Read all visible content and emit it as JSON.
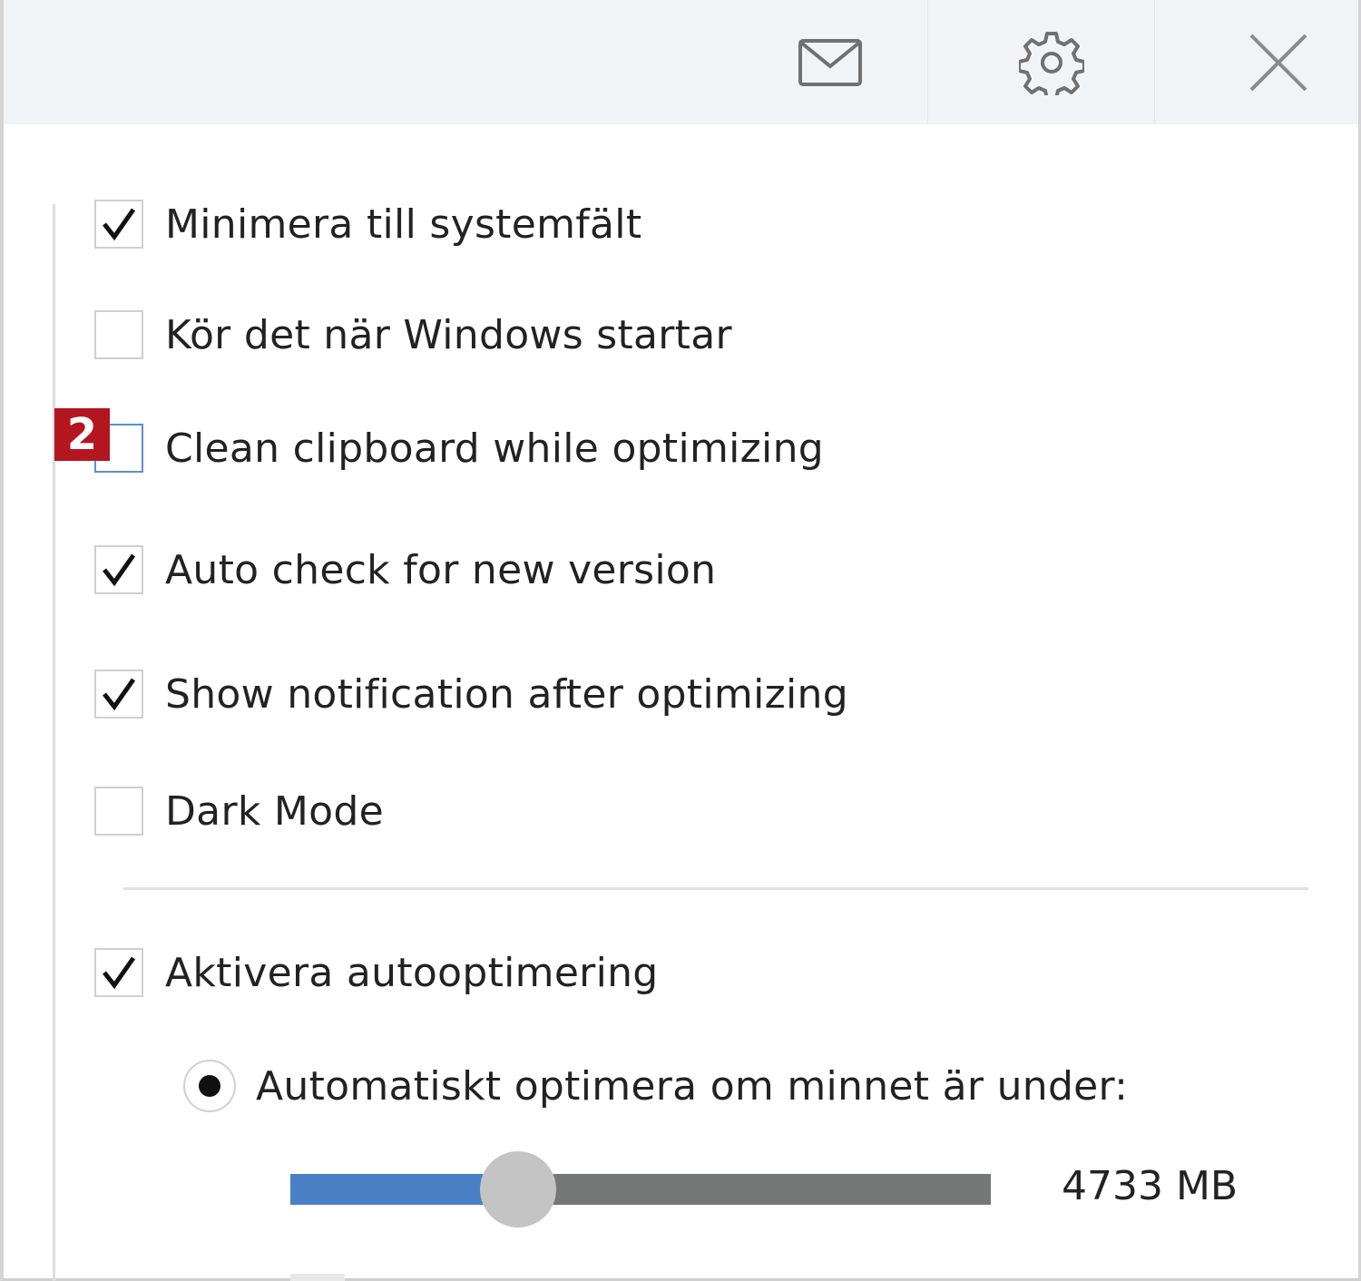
{
  "header": {
    "icons": [
      "mail-icon",
      "gear-icon",
      "close-icon"
    ]
  },
  "badge": "2",
  "settings": [
    {
      "label": "Minimera till systemfält",
      "checked": true
    },
    {
      "label": "Kör det när Windows startar",
      "checked": false
    },
    {
      "label": "Clean clipboard while optimizing",
      "checked": false,
      "focused": true
    },
    {
      "label": "Auto check for new version",
      "checked": true
    },
    {
      "label": "Show notification after optimizing",
      "checked": true
    },
    {
      "label": "Dark Mode",
      "checked": false
    }
  ],
  "auto": {
    "enable_label": "Aktivera autooptimering",
    "enable_checked": true,
    "radio_label": "Automatiskt optimera om minnet är under:",
    "radio_selected": true,
    "slider_fraction": 0.325,
    "slider_value": "4733 MB"
  },
  "colors": {
    "header_bg": "#f1f4f7",
    "slider_fill": "#4a7fc6",
    "slider_track": "#747775",
    "badge": "#b3161f"
  }
}
